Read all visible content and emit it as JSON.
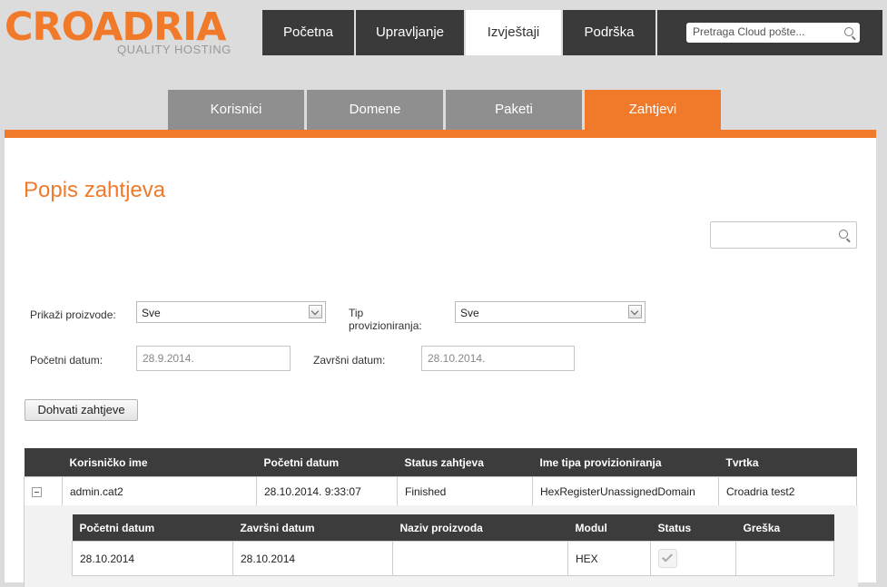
{
  "logo": {
    "word": "CROADRIA",
    "tagline": "QUALITY HOSTING"
  },
  "topnav": [
    {
      "label": "Početna",
      "active": false
    },
    {
      "label": "Upravljanje",
      "active": false
    },
    {
      "label": "Izvještaji",
      "active": true
    },
    {
      "label": "Podrška",
      "active": false
    }
  ],
  "top_search": {
    "placeholder": "Pretraga Cloud pošte..."
  },
  "subnav": [
    {
      "label": "Korisnici",
      "active": false
    },
    {
      "label": "Domene",
      "active": false
    },
    {
      "label": "Paketi",
      "active": false
    },
    {
      "label": "Zahtjevi",
      "active": true
    }
  ],
  "page": {
    "title": "Popis zahtjeva"
  },
  "filters": {
    "products_label": "Prikaži proizvode:",
    "products_value": "Sve",
    "prov_type_label_line1": "Tip",
    "prov_type_label_line2": "provizioniranja:",
    "prov_type_value": "Sve",
    "start_label": "Početni datum:",
    "start_value": "28.9.2014.",
    "end_label": "Završni datum:",
    "end_value": "28.10.2014.",
    "fetch_button": "Dohvati zahtjeve"
  },
  "requests_table": {
    "headers": [
      "",
      "Korisničko ime",
      "Početni datum",
      "Status zahtjeva",
      "Ime tipa provizioniranja",
      "Tvrtka"
    ],
    "rows": [
      {
        "username": "admin.cat2",
        "start": "28.10.2014. 9:33:07",
        "status": "Finished",
        "prov_type": "HexRegisterUnassignedDomain",
        "company": "Croadria test2"
      }
    ]
  },
  "detail_table": {
    "headers": [
      "Početni datum",
      "Završni datum",
      "Naziv proizvoda",
      "Modul",
      "Status",
      "Greška"
    ],
    "rows": [
      {
        "start": "28.10.2014",
        "end": "28.10.2014",
        "product": "",
        "module": "HEX",
        "error": ""
      }
    ]
  },
  "colors": {
    "accent": "#f07a2a",
    "dark": "#3a3a3a",
    "tab_gray": "#8f8f8f",
    "background": "#dcdcdc"
  }
}
